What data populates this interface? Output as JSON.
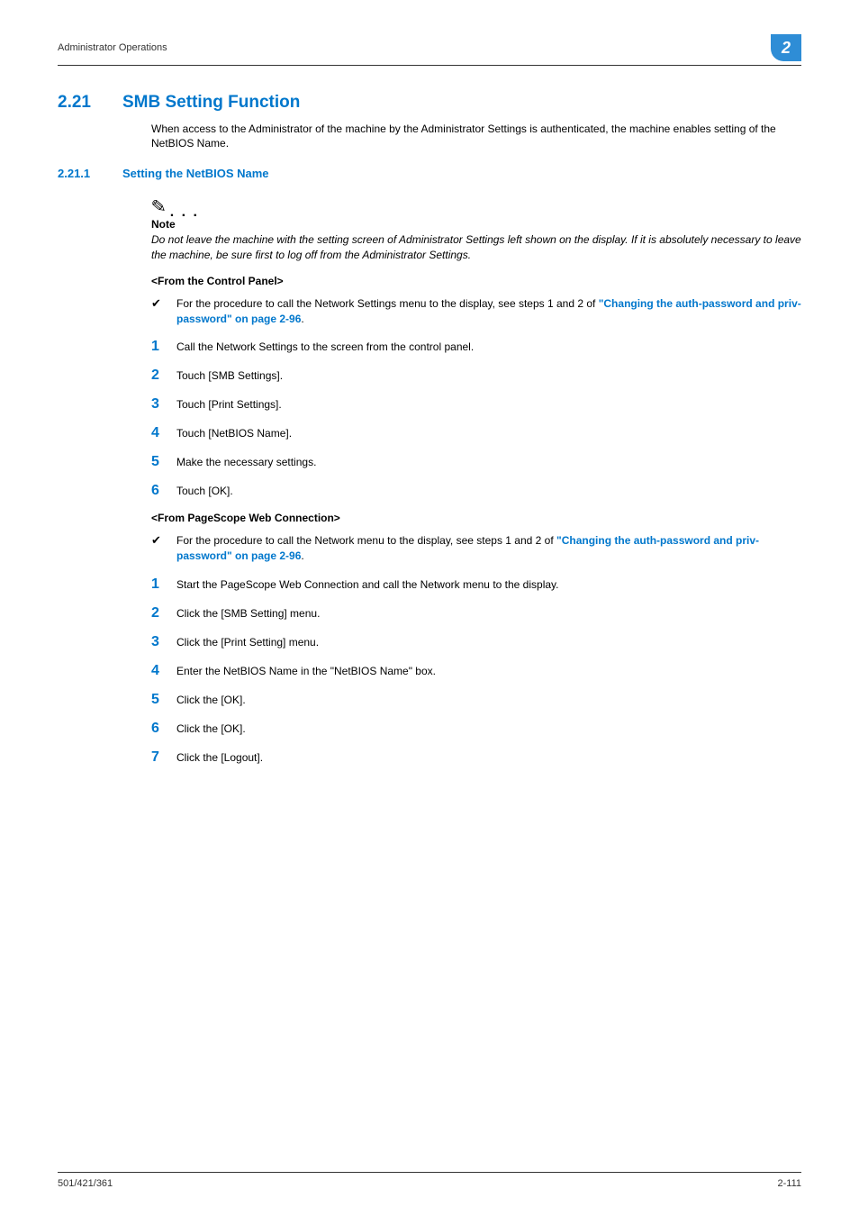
{
  "header": {
    "left": "Administrator Operations",
    "badge": "2"
  },
  "h1": {
    "num": "2.21",
    "text": "SMB Setting Function"
  },
  "intro": "When access to the Administrator of the machine by the Administrator Settings is authenticated, the machine enables setting of the NetBIOS Name.",
  "h2": {
    "num": "2.21.1",
    "text": "Setting the NetBIOS Name"
  },
  "note": {
    "label": "Note",
    "body": "Do not leave the machine with the setting screen of Administrator Settings left shown on the display. If it is absolutely necessary to leave the machine, be sure first to log off from the Administrator Settings."
  },
  "sectionA": {
    "head": "<From the Control Panel>",
    "check_pre": "For the procedure to call the Network Settings menu to the display, see steps 1 and 2 of ",
    "check_link": "\"Changing the auth-password and priv-password\" on page 2-96",
    "check_post": ".",
    "steps": [
      "Call the Network Settings to the screen from the control panel.",
      "Touch [SMB Settings].",
      "Touch [Print Settings].",
      "Touch [NetBIOS Name].",
      "Make the necessary settings.",
      "Touch [OK]."
    ]
  },
  "sectionB": {
    "head": "<From PageScope Web Connection>",
    "check_pre": "For the procedure to call the Network menu to the display, see steps 1 and 2 of ",
    "check_link": "\"Changing the auth-password and priv-password\" on page 2-96",
    "check_post": ".",
    "steps": [
      "Start the PageScope Web Connection and call the Network menu to the display.",
      "Click the [SMB Setting] menu.",
      "Click the [Print Setting] menu.",
      "Enter the NetBIOS Name in the \"NetBIOS Name\" box.",
      "Click the [OK].",
      "Click the [OK].",
      "Click the [Logout]."
    ]
  },
  "footer": {
    "left": "501/421/361",
    "right": "2-111"
  },
  "nums": [
    "1",
    "2",
    "3",
    "4",
    "5",
    "6",
    "7"
  ]
}
